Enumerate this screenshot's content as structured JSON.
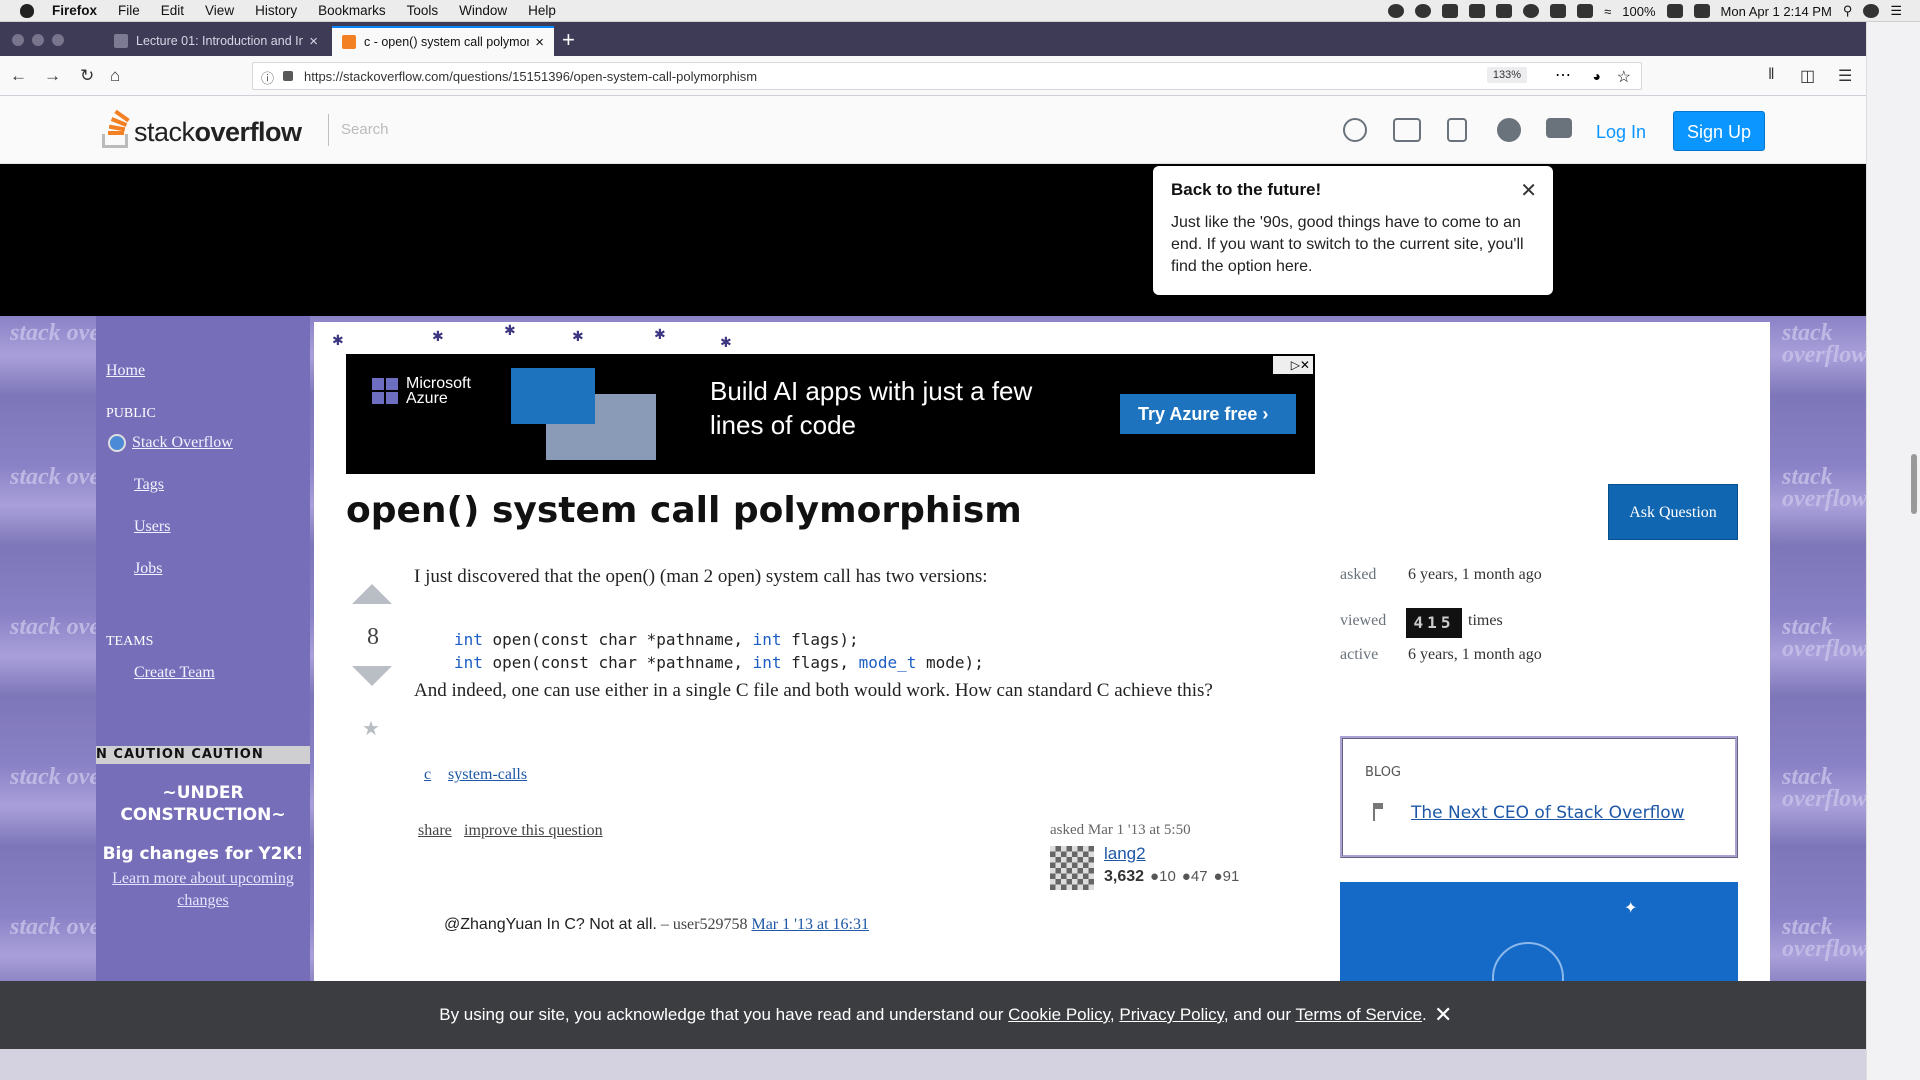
{
  "menubar": {
    "app": "Firefox",
    "items": [
      "File",
      "Edit",
      "View",
      "History",
      "Bookmarks",
      "Tools",
      "Window",
      "Help"
    ],
    "battery": "100%",
    "clock": "Mon Apr 1  2:14 PM"
  },
  "tabs": [
    {
      "title": "Lecture 01: Introduction and In",
      "active": false
    },
    {
      "title": "c - open() system call polymor",
      "active": true
    }
  ],
  "nav": {
    "url": "https://stackoverflow.com/questions/15151396/open-system-call-polymorphism",
    "zoom": "133%"
  },
  "so_header": {
    "logo_light": "stack",
    "logo_bold": "overflow",
    "search_placeholder": "Search",
    "login": "Log In",
    "signup": "Sign Up"
  },
  "tooltip": {
    "title": "Back to the future!",
    "body": "Just like the '90s, good things have to come to an end. If you want to switch to the current site, you'll find the option here."
  },
  "background_tile_text": "stack overflow",
  "sidebar": {
    "home": "Home",
    "public_heading": "PUBLIC",
    "items": [
      "Stack Overflow",
      "Tags",
      "Users",
      "Jobs"
    ],
    "teams_heading": "TEAMS",
    "create_team": "Create Team",
    "caution": "N  CAUTION  CAUTION",
    "under_construction": "~UNDER CONSTRUCTION~",
    "big_changes": "Big changes for Y2K!",
    "learn_more": "Learn more about upcoming changes"
  },
  "ad": {
    "brand_line1": "Microsoft",
    "brand_line2": "Azure",
    "headline_line1": "Build AI apps with just a few",
    "headline_line2": "lines of code",
    "cta": "Try Azure free"
  },
  "question": {
    "title": "open() system call polymorphism",
    "ask_button": "Ask Question",
    "votes": "8",
    "intro": "I just discovered that the open() (man 2 open) system call has two versions:",
    "code_line1_kw": "int",
    "code_line1_rest": " open(const char *pathname, ",
    "code_line1_kw2": "int",
    "code_line1_end": " flags);",
    "code_line2_kw": "int",
    "code_line2_rest": " open(const char *pathname, ",
    "code_line2_kw2": "int",
    "code_line2_mid": " flags, ",
    "code_line2_kw3": "mode_t",
    "code_line2_end": " mode);",
    "followup": "And indeed, one can use either in a single C file and both would work. How can standard C achieve this?",
    "tags": [
      "c",
      "system-calls"
    ],
    "share": "share",
    "improve": "improve this question",
    "asked_label": "asked Mar 1 '13 at 5:50",
    "user_name": "lang2",
    "user_rep": "3,632",
    "badges": [
      "●10",
      "●47",
      "●91"
    ],
    "comment_text": "@ZhangYuan In C? Not at all.",
    "comment_by": " – user529758 ",
    "comment_date": "Mar 1 '13 at 16:31"
  },
  "stats": {
    "asked_label": "asked",
    "asked_value": "6 years, 1 month ago",
    "viewed_label": "viewed",
    "viewed_counter": "415",
    "viewed_suffix": "times",
    "active_label": "active",
    "active_value": "6 years, 1 month ago"
  },
  "blog": {
    "heading": "BLOG",
    "link": "The Next CEO of Stack Overflow"
  },
  "cookie": {
    "text1": "By using our site, you acknowledge that you have read and understand our ",
    "link1": "Cookie Policy",
    "sep1": ", ",
    "link2": "Privacy Policy",
    "sep2": ", and our ",
    "link3": "Terms of Service",
    "end": "."
  }
}
